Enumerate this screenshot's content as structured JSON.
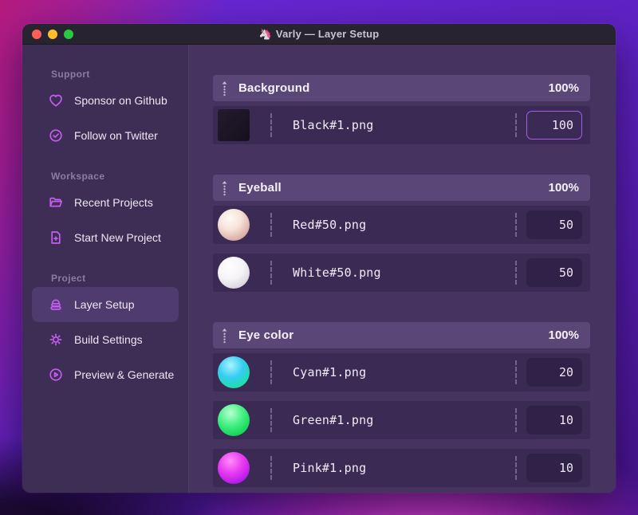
{
  "window": {
    "title": "Varly — Layer Setup",
    "app_icon": "🦄",
    "traffic_lights": [
      {
        "name": "close-button",
        "color": "#ff5f57"
      },
      {
        "name": "minimize-button",
        "color": "#febc2e"
      },
      {
        "name": "zoom-button",
        "color": "#28c840"
      }
    ]
  },
  "sidebar": {
    "sections": [
      {
        "label": "Support",
        "items": [
          {
            "icon": "heart-icon",
            "label": "Sponsor on Github",
            "selected": false
          },
          {
            "icon": "badge-check-icon",
            "label": "Follow on Twitter",
            "selected": false
          }
        ]
      },
      {
        "label": "Workspace",
        "items": [
          {
            "icon": "folder-open-icon",
            "label": "Recent Projects",
            "selected": false
          },
          {
            "icon": "file-plus-icon",
            "label": "Start New Project",
            "selected": false
          }
        ]
      },
      {
        "label": "Project",
        "items": [
          {
            "icon": "layers-icon",
            "label": "Layer Setup",
            "selected": true
          },
          {
            "icon": "gear-icon",
            "label": "Build Settings",
            "selected": false
          },
          {
            "icon": "play-circle-icon",
            "label": "Preview & Generate",
            "selected": false
          }
        ]
      }
    ]
  },
  "layer_setup": {
    "groups": [
      {
        "name": "Background",
        "weight": "100%",
        "rows": [
          {
            "thumb": "black",
            "file": "Black#1.png",
            "value": "100",
            "focused": true
          }
        ]
      },
      {
        "name": "Eyeball",
        "weight": "100%",
        "rows": [
          {
            "thumb": "red",
            "file": "Red#50.png",
            "value": "50",
            "focused": false
          },
          {
            "thumb": "white",
            "file": "White#50.png",
            "value": "50",
            "focused": false
          }
        ]
      },
      {
        "name": "Eye color",
        "weight": "100%",
        "rows": [
          {
            "thumb": "cyan",
            "file": "Cyan#1.png",
            "value": "20",
            "focused": false
          },
          {
            "thumb": "green",
            "file": "Green#1.png",
            "value": "10",
            "focused": false
          },
          {
            "thumb": "pink",
            "file": "Pink#1.png",
            "value": "10",
            "focused": false
          }
        ]
      }
    ]
  },
  "colors": {
    "accent": "#c55ef0",
    "focus_border": "#a55df0",
    "sidebar_bg": "#3e2d54",
    "main_bg": "#46335f",
    "group_header_bg": "#5a4778",
    "row_bg": "#3b2a53",
    "titlebar_bg": "#272330"
  }
}
